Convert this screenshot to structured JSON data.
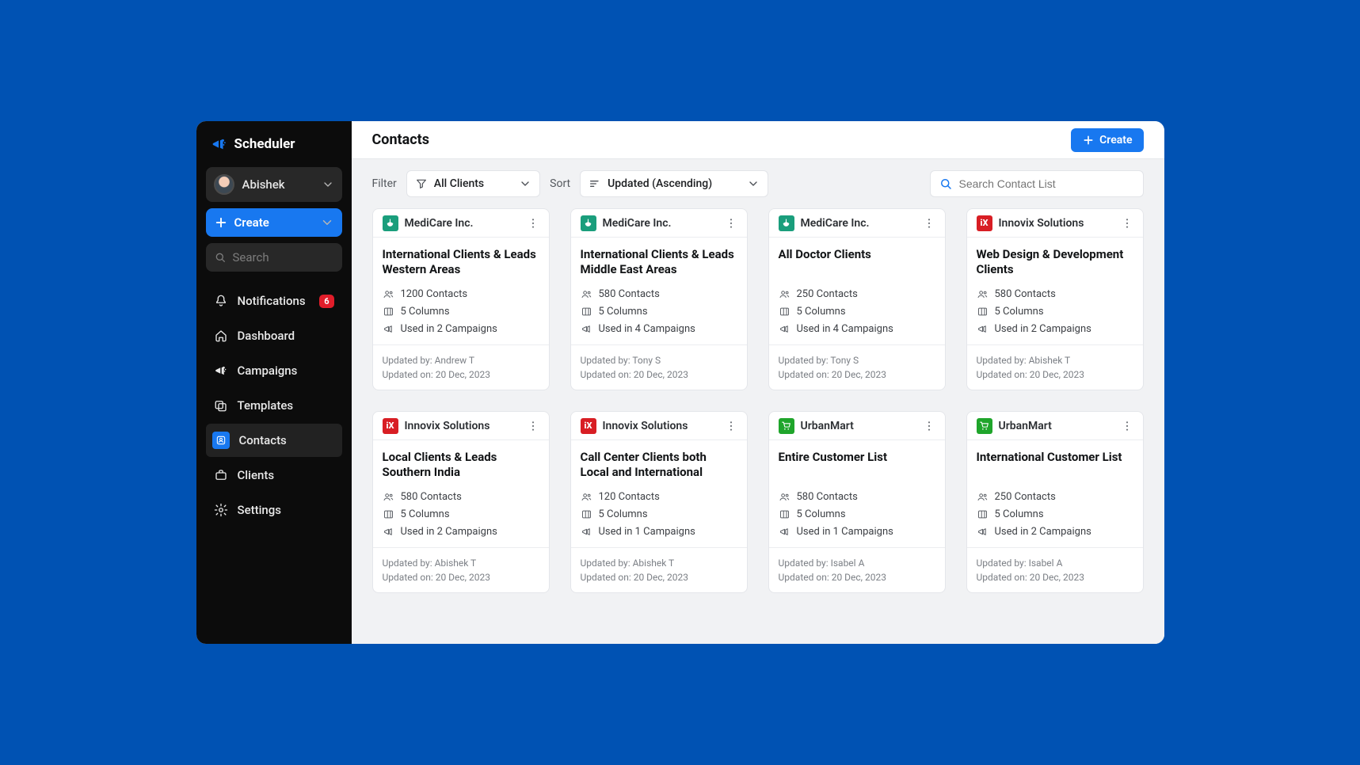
{
  "brand": "Scheduler",
  "sidebar": {
    "user": "Abishek",
    "create_label": "Create",
    "search_placeholder": "Search",
    "nav": [
      {
        "icon": "bell",
        "label": "Notifications",
        "badge": "6"
      },
      {
        "icon": "home",
        "label": "Dashboard"
      },
      {
        "icon": "megaphone",
        "label": "Campaigns"
      },
      {
        "icon": "templates",
        "label": "Templates"
      },
      {
        "icon": "contacts",
        "label": "Contacts",
        "active": true
      },
      {
        "icon": "briefcase",
        "label": "Clients"
      },
      {
        "icon": "gear",
        "label": "Settings"
      }
    ]
  },
  "page": {
    "title": "Contacts",
    "create_label": "Create",
    "filter_label": "Filter",
    "filter_value": "All Clients",
    "sort_label": "Sort",
    "sort_value": "Updated (Ascending)",
    "search_placeholder": "Search Contact List"
  },
  "clients": {
    "medicare": {
      "name": "MediCare Inc.",
      "color": "#1a9e7c",
      "icon": "medical"
    },
    "innovix": {
      "name": "Innovix Solutions",
      "color": "#d81e24",
      "icon": "ix"
    },
    "urbanmart": {
      "name": "UrbanMart",
      "color": "#1fa52b",
      "icon": "cart"
    }
  },
  "cards": [
    {
      "client": "medicare",
      "title": "International Clients & Leads Western Areas",
      "contacts": "1200 Contacts",
      "columns": "5 Columns",
      "campaigns": "Used in 2 Campaigns",
      "updated_by": "Updated by: Andrew T",
      "updated_on": "Updated on: 20 Dec, 2023"
    },
    {
      "client": "medicare",
      "title": "International Clients & Leads Middle East Areas",
      "contacts": "580 Contacts",
      "columns": "5 Columns",
      "campaigns": "Used in 4 Campaigns",
      "updated_by": "Updated by: Tony S",
      "updated_on": "Updated on: 20 Dec, 2023"
    },
    {
      "client": "medicare",
      "title": "All Doctor Clients",
      "contacts": "250 Contacts",
      "columns": "5 Columns",
      "campaigns": "Used in 4 Campaigns",
      "updated_by": "Updated by: Tony S",
      "updated_on": "Updated on: 20 Dec, 2023"
    },
    {
      "client": "innovix",
      "title": "Web Design & Development Clients",
      "contacts": "580 Contacts",
      "columns": "5 Columns",
      "campaigns": "Used in 2 Campaigns",
      "updated_by": "Updated by: Abishek T",
      "updated_on": "Updated on: 20 Dec, 2023"
    },
    {
      "client": "innovix",
      "title": "Local Clients & Leads Southern India",
      "contacts": "580 Contacts",
      "columns": "5 Columns",
      "campaigns": "Used in 2 Campaigns",
      "updated_by": "Updated by: Abishek T",
      "updated_on": "Updated on: 20 Dec, 2023"
    },
    {
      "client": "innovix",
      "title": "Call Center Clients both Local and International",
      "contacts": "120 Contacts",
      "columns": "5 Columns",
      "campaigns": "Used in 1 Campaigns",
      "updated_by": "Updated by: Abishek T",
      "updated_on": "Updated on: 20 Dec, 2023"
    },
    {
      "client": "urbanmart",
      "title": "Entire Customer List",
      "contacts": "580 Contacts",
      "columns": "5 Columns",
      "campaigns": "Used in 1 Campaigns",
      "updated_by": "Updated by: Isabel A",
      "updated_on": "Updated on: 20 Dec, 2023"
    },
    {
      "client": "urbanmart",
      "title": "International Customer List",
      "contacts": "250 Contacts",
      "columns": "5 Columns",
      "campaigns": "Used in 2 Campaigns",
      "updated_by": "Updated by: Isabel A",
      "updated_on": "Updated on: 20 Dec, 2023"
    }
  ]
}
